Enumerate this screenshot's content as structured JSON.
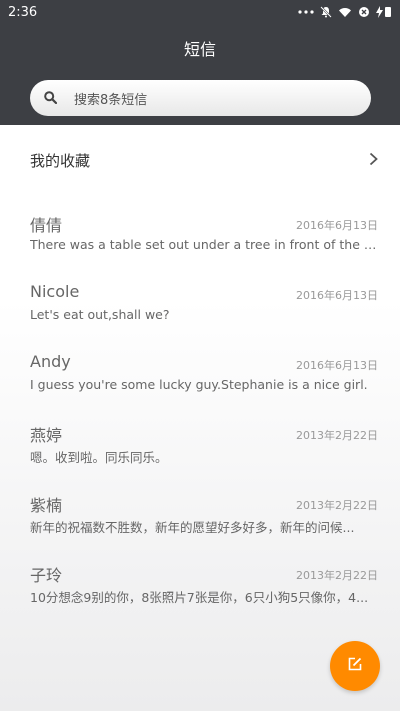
{
  "status_bar": {
    "time": "2:36"
  },
  "header": {
    "title": "短信"
  },
  "search": {
    "placeholder": "搜索8条短信"
  },
  "favorites": {
    "label": "我的收藏"
  },
  "messages": [
    {
      "name": "倩倩",
      "date": "2016年6月13日",
      "preview": "There was a table set out under a tree in front of the ho..."
    },
    {
      "name": "Nicole",
      "date": "2016年6月13日",
      "preview": "Let's eat out,shall we?"
    },
    {
      "name": "Andy",
      "date": "2016年6月13日",
      "preview": "I guess you're some lucky guy.Stephanie is a nice girl."
    },
    {
      "name": "燕婷",
      "date": "2013年2月22日",
      "preview": "嗯。收到啦。同乐同乐。"
    },
    {
      "name": "紫楠",
      "date": "2013年2月22日",
      "preview": "新年的祝福数不胜数，新年的愿望好多好多，新年的问候..."
    },
    {
      "name": "子玲",
      "date": "2013年2月22日",
      "preview": "10分想念9别的你，8张照片7张是你，6只小狗5只像你，4..."
    }
  ],
  "colors": {
    "header_bg": "#3d3f44",
    "fab": "#ff8a00"
  },
  "icons": {
    "status": [
      "more-dots-icon",
      "mute-bell-icon",
      "wifi-icon",
      "sim-icon",
      "battery-charging-icon"
    ],
    "search": "search-icon",
    "favorites": "chevron-right-icon",
    "fab": "compose-icon"
  }
}
